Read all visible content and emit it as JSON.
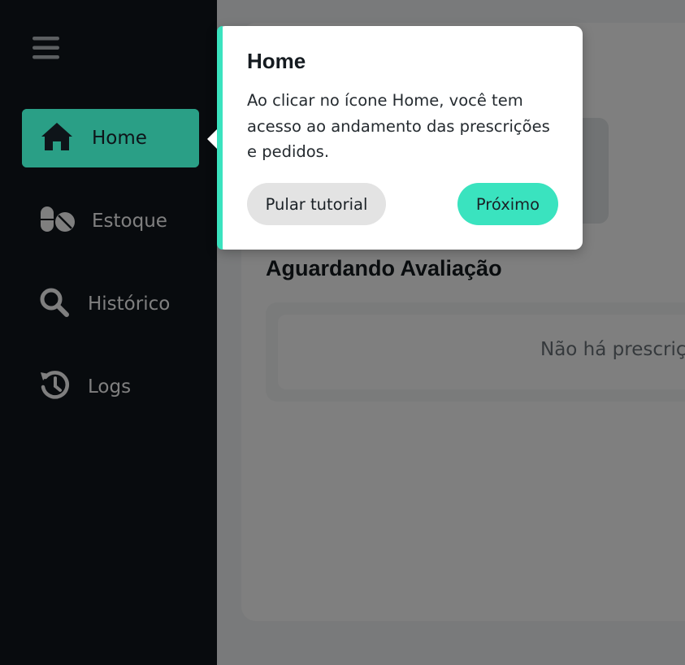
{
  "sidebar": {
    "menu_icon": "hamburger-menu-icon",
    "items": [
      {
        "label": "Home",
        "icon": "home-icon",
        "active": true
      },
      {
        "label": "Estoque",
        "icon": "pills-icon",
        "active": false
      },
      {
        "label": "Histórico",
        "icon": "search-icon",
        "active": false
      },
      {
        "label": "Logs",
        "icon": "history-clock-icon",
        "active": false
      }
    ]
  },
  "main": {
    "section_title": "Aguardando Avaliação",
    "empty_message": "Não há prescrições"
  },
  "tutorial": {
    "title": "Home",
    "body": "Ao clicar no ícone Home, você tem acesso ao andamento das prescrições e pedidos.",
    "skip_label": "Pular tutorial",
    "next_label": "Próximo"
  },
  "colors": {
    "sidebar_bg": "#10171d",
    "accent": "#3ae3bf",
    "overlay": "rgba(0,0,0,0.5)"
  }
}
